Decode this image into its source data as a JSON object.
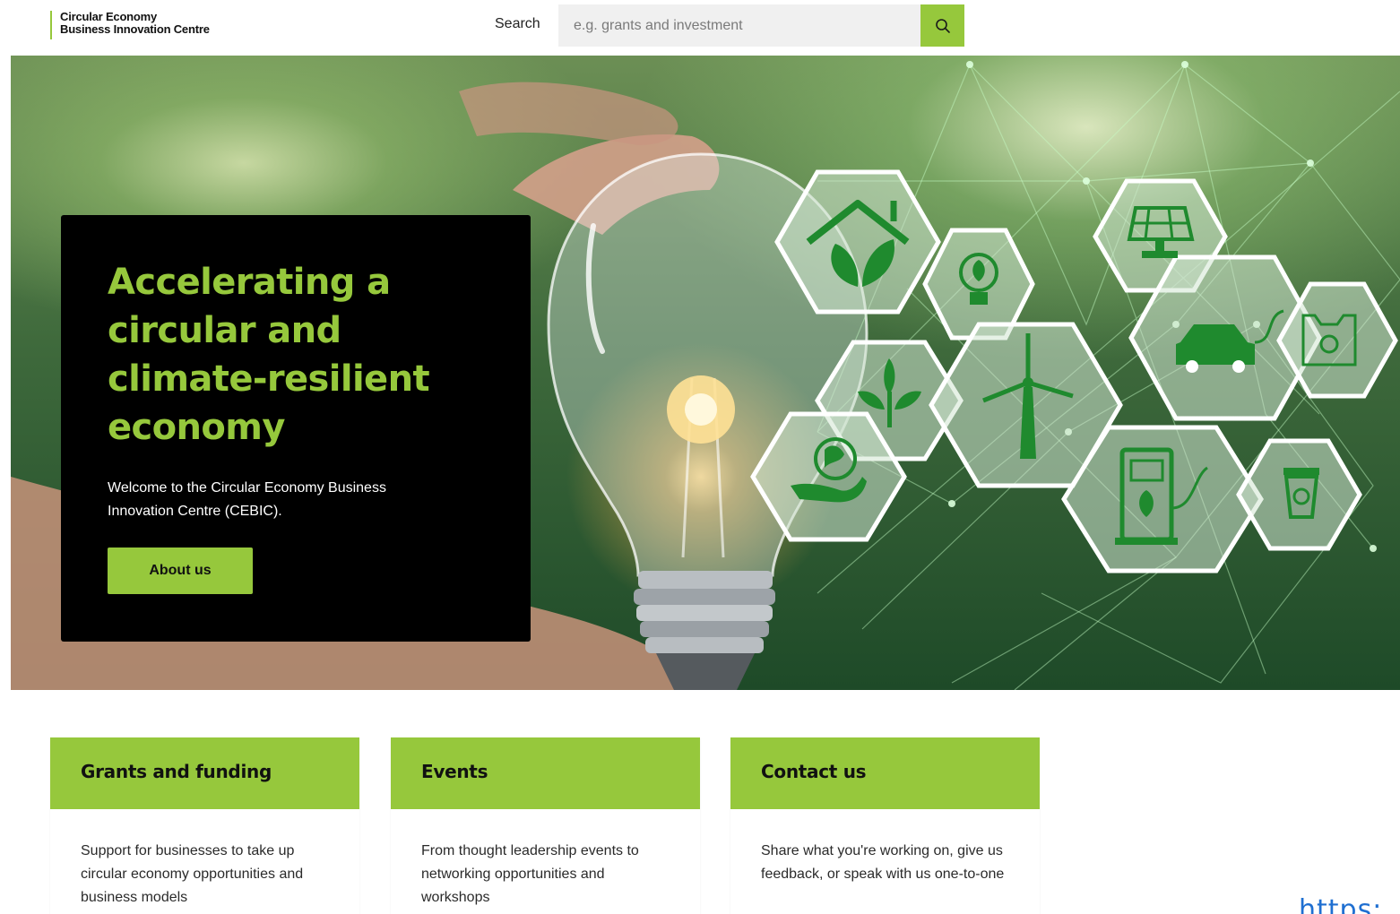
{
  "header": {
    "logo_line1": "Circular Economy",
    "logo_line2": "Business Innovation Centre",
    "search_label": "Search",
    "search_placeholder": "e.g. grants and investment",
    "search_icon": "search-icon"
  },
  "hero": {
    "title": "Accelerating a circular and climate-resilient economy",
    "intro": "Welcome to the Circular Economy Business Innovation Centre (CEBIC).",
    "button_label": "About us",
    "icons": [
      "house-leaf-icon",
      "bulb-leaf-icon",
      "solar-panel-icon",
      "electric-car-icon",
      "recycle-bag-icon",
      "plant-icon",
      "wind-turbine-icon",
      "globe-hand-icon",
      "ev-charger-icon",
      "recycle-bin-icon"
    ]
  },
  "cards": [
    {
      "title": "Grants and funding",
      "text": "Support for businesses to take up circular economy opportunities and business models"
    },
    {
      "title": "Events",
      "text": "From thought leadership events to networking opportunities and workshops"
    },
    {
      "title": "Contact us",
      "text": "Share what you're working on, give us feedback, or speak with us one-to-one"
    }
  ],
  "overlay_text": "https:",
  "colors": {
    "accent": "#96c83c",
    "card_bg": "#000000",
    "icon_green": "#1f8a2e",
    "link_blue": "#1f6fd1"
  }
}
